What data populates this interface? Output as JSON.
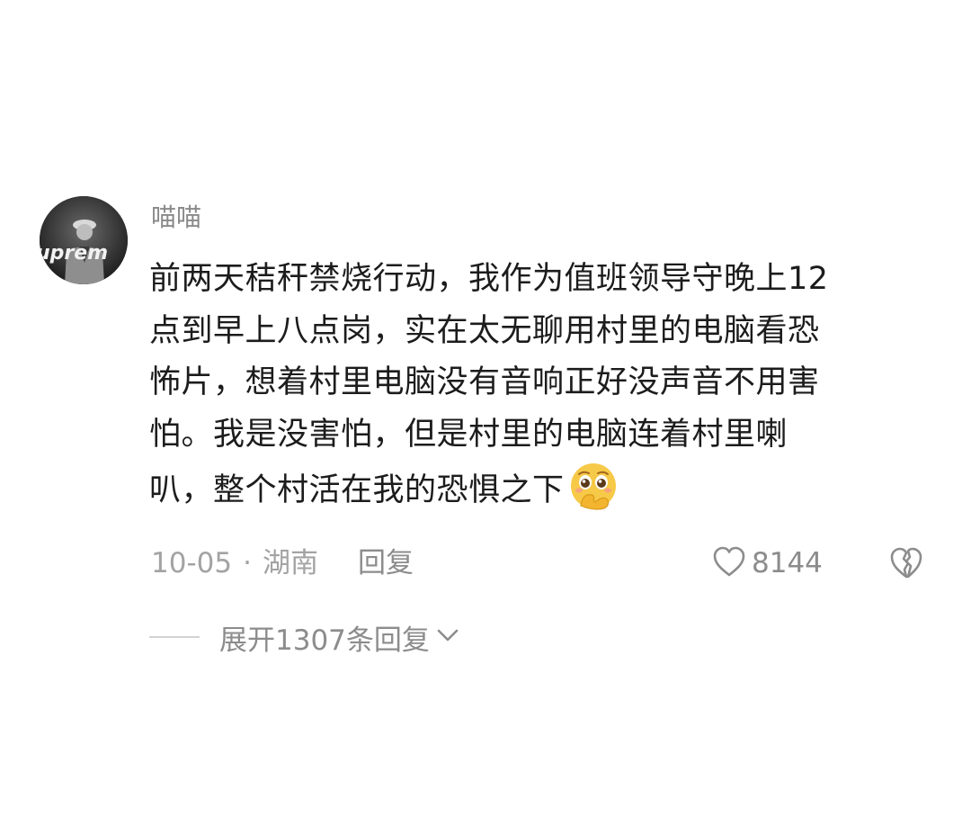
{
  "comment": {
    "username": "喵喵",
    "avatar_text": "uprem",
    "body_lines": [
      "前两天秸秆禁烧行动，我作为值班领导守晚上12",
      "点到早上八点岗，实在太无聊用村里的电脑看恐",
      "怖片，想着村里电脑没有音响正好没声音不用害",
      "怕。我是没害怕，但是村里的电脑连着村里喇",
      "叭，整个村活在我的恐惧之下"
    ],
    "emoji": "face-holding-back-tears-icon",
    "date": "10-05",
    "separator": "·",
    "location": "湖南",
    "reply_label": "回复",
    "like_count": "8144",
    "expand_label": "展开1307条回复"
  },
  "colors": {
    "text": "#1c1c1c",
    "muted": "#a3a3a3",
    "username": "#8a8a8a",
    "emoji": "#f7c948"
  }
}
